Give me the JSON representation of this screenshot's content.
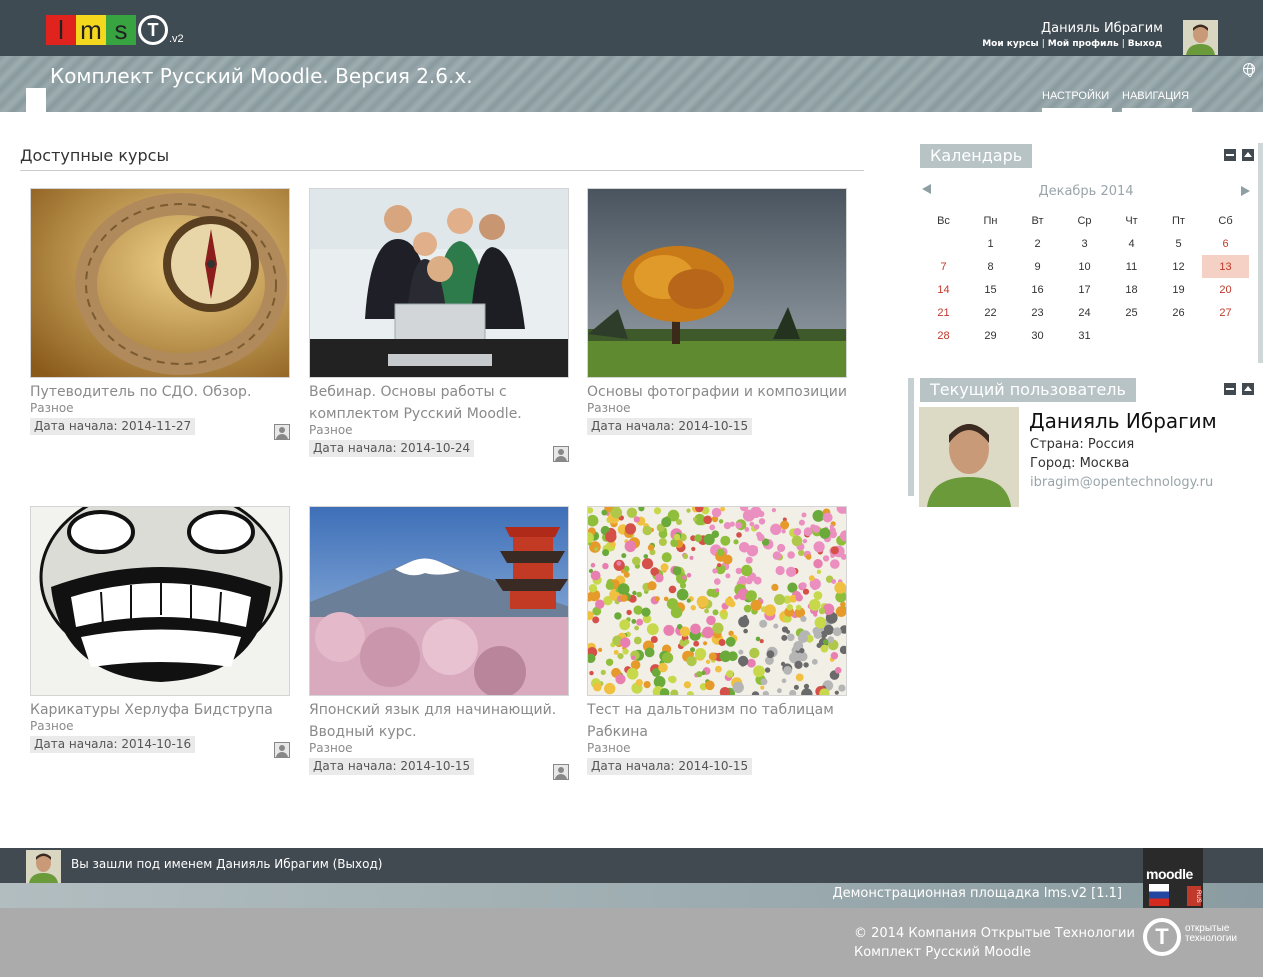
{
  "header": {
    "logo": {
      "l": "l",
      "m": "m",
      "s": "s",
      "t": "T",
      "version": ".v2"
    },
    "user_name": "Данияль Ибрагим",
    "links": [
      "Мои курсы",
      "Мой профиль",
      "Выход"
    ],
    "link_separator": "|",
    "avatar_icon": "user-avatar-photo"
  },
  "banner": {
    "title": "Комплект Русский Moodle. Версия 2.6.x.",
    "nav": {
      "settings": "НАСТРОЙКИ",
      "navigation": "НАВИГАЦИЯ"
    },
    "globe_icon": "globe-icon"
  },
  "main": {
    "section_title": "Доступные курсы",
    "courses": [
      {
        "name": "Путеводитель по СДО. Обзор.",
        "category": "Разное",
        "date": "Дата начала: 2014-11-27",
        "image": "compass-map"
      },
      {
        "name": "Вебинар. Основы работы с комплектом Русский Moodle.",
        "category": "Разное",
        "date": "Дата начала: 2014-10-24",
        "image": "team-laptop"
      },
      {
        "name": "Основы фотографии и композиции",
        "category": "Разное",
        "date": "Дата начала: 2014-10-15",
        "image": "autumn-tree"
      },
      {
        "name": "Карикатуры Херлуфа Бидструпа",
        "category": "Разное",
        "date": "Дата начала: 2014-10-16",
        "image": "caricature"
      },
      {
        "name": "Японский язык для начинающий. Вводный курс.",
        "category": "Разное",
        "date": "Дата начала: 2014-10-15",
        "image": "mount-fuji"
      },
      {
        "name": "Тест на дальтонизм по таблицам Рабкина",
        "category": "Разное",
        "date": "Дата начала: 2014-10-15",
        "image": "color-dots"
      }
    ]
  },
  "calendar": {
    "title": "Календарь",
    "month": "Декабрь 2014",
    "weekdays": [
      "Вс",
      "Пн",
      "Вт",
      "Ср",
      "Чт",
      "Пт",
      "Сб"
    ],
    "weeks": [
      [
        "",
        "1",
        "2",
        "3",
        "4",
        "5",
        "6"
      ],
      [
        "7",
        "8",
        "9",
        "10",
        "11",
        "12",
        "13"
      ],
      [
        "14",
        "15",
        "16",
        "17",
        "18",
        "19",
        "20"
      ],
      [
        "21",
        "22",
        "23",
        "24",
        "25",
        "26",
        "27"
      ],
      [
        "28",
        "29",
        "30",
        "31",
        "",
        "",
        ""
      ]
    ],
    "today": "13",
    "weekend_color": "#c0392b"
  },
  "current_user": {
    "title": "Текущий пользователь",
    "name": "Данияль Ибрагим",
    "country": "Страна: Россия",
    "city": "Город: Москва",
    "email": "ibragim@opentechnology.ru"
  },
  "footer": {
    "login_info": "Вы зашли под именем Данияль Ибрагим (Выход)",
    "demo": "Демонстрационная площадка lms.v2 [1.1]",
    "copyright": "© 2014 Компания Открытые Технологии",
    "product": "Комплект Русский Moodle",
    "moodle_logo": {
      "text": "moodle",
      "badge": "RUS"
    },
    "ot_logo": {
      "mark": "T",
      "line1": "открытые",
      "line2": "технологии"
    }
  },
  "colors": {
    "header": "#3f4b52",
    "accent": "#b8c3c6",
    "link": "#8a8a8a",
    "today": "#f5d0c4"
  }
}
